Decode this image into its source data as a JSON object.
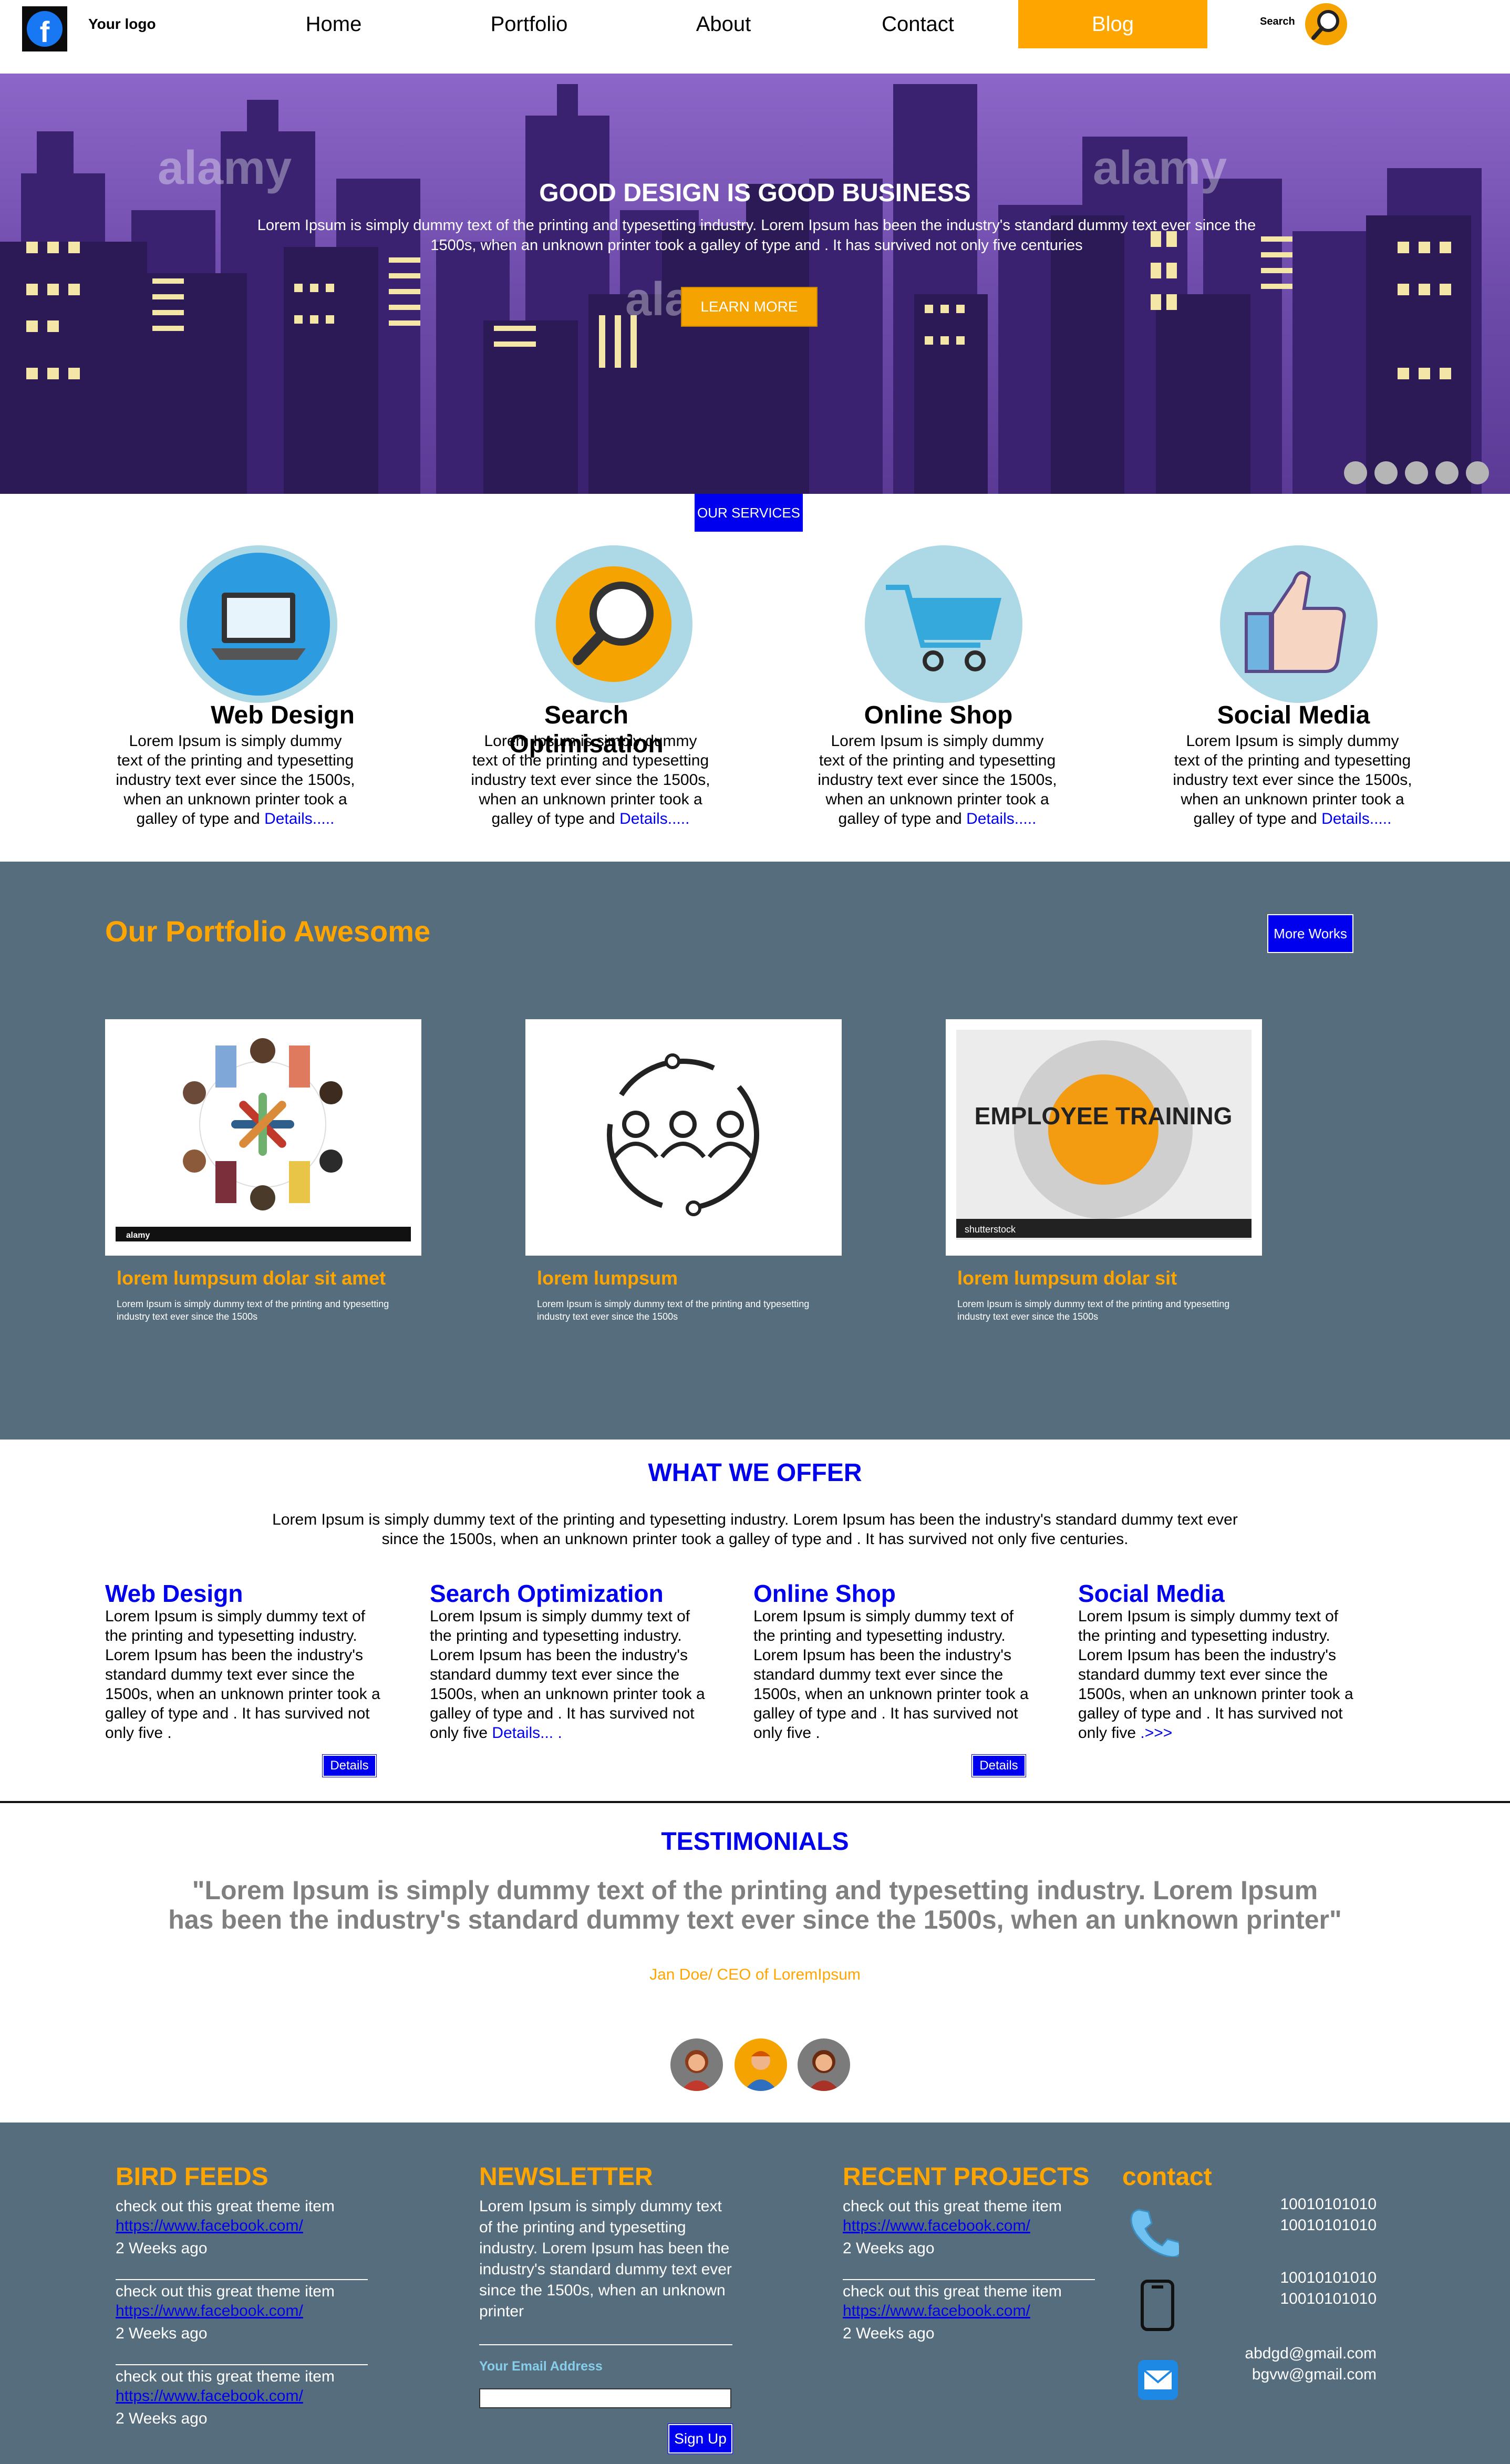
{
  "header": {
    "logo_text": "Your logo",
    "nav": [
      "Home",
      "Portfolio",
      "About",
      "Contact",
      "Blog"
    ],
    "active_nav": "Blog",
    "search_label": "Search"
  },
  "hero": {
    "title": "GOOD DESIGN IS GOOD BUSINESS",
    "text": "Lorem Ipsum is simply dummy text of the printing and typesetting industry. Lorem Ipsum has been the industry's standard dummy text ever since the 1500s, when an unknown printer took a galley of type and . It has survived not only five centuries",
    "button": "LEARN MORE",
    "watermark": "alamy"
  },
  "services": {
    "tab_label": "OUR SERVICES",
    "items": [
      {
        "title": "Web Design",
        "text": "Lorem Ipsum is simply dummy text of the printing and typesetting industry text ever since the 1500s, when an unknown printer took a galley of type and",
        "link": "Details....."
      },
      {
        "title": "Search Optimisation",
        "text": "Lorem Ipsum is simply dummy text of the printing and typesetting industry text ever since the 1500s, when an unknown printer took a galley of type and",
        "link": "Details....."
      },
      {
        "title": "Online Shop",
        "text": "Lorem Ipsum is simply dummy text of the printing and typesetting industry text ever since the 1500s, when an unknown printer took a galley of type and",
        "link": "Details....."
      },
      {
        "title": "Social Media",
        "text": "Lorem Ipsum is simply dummy text of the printing and typesetting industry text ever since the 1500s, when an unknown printer took a galley of type and",
        "link": "Details....."
      }
    ]
  },
  "portfolio": {
    "title": "Our Portfolio Awesome",
    "more_button": "More Works",
    "items": [
      {
        "caption": "lorem lumpsum dolar sit amet",
        "desc": "Lorem Ipsum is simply dummy text of the printing and typesetting industry text ever since the 1500s",
        "image_text": "alamy"
      },
      {
        "caption": "lorem lumpsum",
        "desc": "Lorem Ipsum is simply dummy text of the printing and typesetting industry text ever since the 1500s"
      },
      {
        "caption": "lorem lumpsum dolar sit",
        "desc": "Lorem Ipsum is simply dummy text of the printing and typesetting industry text ever since the 1500s",
        "image_text": "EMPLOYEE TRAINING",
        "image_footer": "shutterstock"
      }
    ]
  },
  "offer": {
    "title": "WHAT WE OFFER",
    "text": "Lorem Ipsum is simply dummy text of the printing and typesetting industry. Lorem Ipsum has been the industry's standard dummy text ever since the 1500s, when an unknown printer took a galley of type and . It has survived not only five centuries.",
    "items": [
      {
        "title": "Web Design",
        "text": "Lorem Ipsum is simply dummy text of the printing and typesetting industry. Lorem Ipsum has been the industry's standard dummy text ever since the 1500s, when an unknown printer took a galley of type and . It has survived not only five .",
        "link": "",
        "button": "Details"
      },
      {
        "title": "Search Optimization",
        "text": "Lorem Ipsum is simply dummy text of the printing and typesetting industry. Lorem Ipsum has been the industry's standard dummy text ever since the 1500s, when an unknown printer took a galley of type and . It has survived not only five",
        "link": "Details... .",
        "button": ""
      },
      {
        "title": "Online Shop",
        "text": "Lorem Ipsum is simply dummy text of the printing and typesetting industry. Lorem Ipsum has been the industry's standard dummy text ever since the 1500s, when an unknown printer took a galley of type and . It has survived not only five .",
        "link": "",
        "button": "Details"
      },
      {
        "title": "Social Media",
        "text": "Lorem Ipsum is simply dummy text of the printing and typesetting industry. Lorem Ipsum has been the industry's standard dummy text ever since the 1500s, when an unknown printer took a galley of type and . It has survived not only five",
        "link": ".>>>",
        "button": ""
      }
    ]
  },
  "testimonials": {
    "title": "TESTIMONIALS",
    "quote": "\"Lorem Ipsum is simply dummy text of the printing and typesetting industry. Lorem Ipsum has been the industry's standard dummy text ever since the 1500s, when an unknown printer\"",
    "author": "Jan Doe/ CEO of LoremIpsum"
  },
  "footer": {
    "bird_feeds": {
      "title": "BIRD FEEDS",
      "items": [
        {
          "text": "check out this great theme item",
          "link": "https://www.facebook.com/",
          "time": "2 Weeks ago"
        },
        {
          "text": "check out this great theme item",
          "link": "https://www.facebook.com/",
          "time": "2 Weeks ago"
        },
        {
          "text": "check out this great theme item",
          "link": "https://www.facebook.com/",
          "time": "2 Weeks ago"
        }
      ]
    },
    "newsletter": {
      "title": "NEWSLETTER",
      "text": "Lorem Ipsum is simply dummy text of the printing and typesetting industry. Lorem Ipsum has been the industry's standard dummy text ever since the 1500s, when an unknown printer",
      "email_label": "Your Email Address",
      "email_value": "",
      "button": "Sign Up"
    },
    "recent_projects": {
      "title": "RECENT PROJECTS",
      "items": [
        {
          "text": "check out this great theme item",
          "link": "https://www.facebook.com/",
          "time": "2 Weeks ago"
        },
        {
          "text": "check out this great theme item",
          "link": "https://www.facebook.com/",
          "time": "2 Weeks ago"
        }
      ]
    },
    "contact": {
      "title": "contact",
      "phone": [
        "10010101010",
        "10010101010"
      ],
      "mobile": [
        "10010101010",
        "10010101010"
      ],
      "email": [
        "abdgd@gmail.com",
        "bgvw@gmail.com"
      ]
    }
  },
  "colors": {
    "accent": "#ffa500",
    "link_blue": "#0000ee",
    "section_bg": "#566d7e",
    "hero_purple": "#6c4aa8"
  }
}
